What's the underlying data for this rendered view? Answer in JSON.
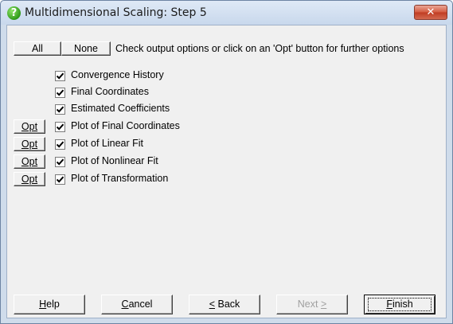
{
  "window": {
    "title": "Multidimensional Scaling: Step 5",
    "help_icon_glyph": "?",
    "close_glyph": "✕"
  },
  "toolbar": {
    "all_label": "All",
    "none_label": "None",
    "instruction": "Check output options or click on an 'Opt' button for further options"
  },
  "options": [
    {
      "label": "Convergence History",
      "checked": true,
      "has_opt": false
    },
    {
      "label": "Final Coordinates",
      "checked": true,
      "has_opt": false
    },
    {
      "label": "Estimated Coefficients",
      "checked": true,
      "has_opt": false
    },
    {
      "label": "Plot of Final Coordinates",
      "checked": true,
      "has_opt": true
    },
    {
      "label": "Plot of Linear Fit",
      "checked": true,
      "has_opt": true
    },
    {
      "label": "Plot of Nonlinear Fit",
      "checked": true,
      "has_opt": true
    },
    {
      "label": "Plot of Transformation",
      "checked": true,
      "has_opt": true
    }
  ],
  "opt_label": "Opt",
  "footer": {
    "help": {
      "mnemonic": "H",
      "rest": "elp"
    },
    "cancel": {
      "mnemonic": "C",
      "rest": "ancel"
    },
    "back": {
      "mnemonic": "<",
      "rest": " Back"
    },
    "next": {
      "prefix": "Next ",
      "mnemonic": ">"
    },
    "finish": {
      "mnemonic": "F",
      "rest": "inish"
    }
  },
  "colors": {
    "accent_title": "#cfdceb",
    "close_red": "#c03b22",
    "help_icon_green": "#2f9a18"
  }
}
